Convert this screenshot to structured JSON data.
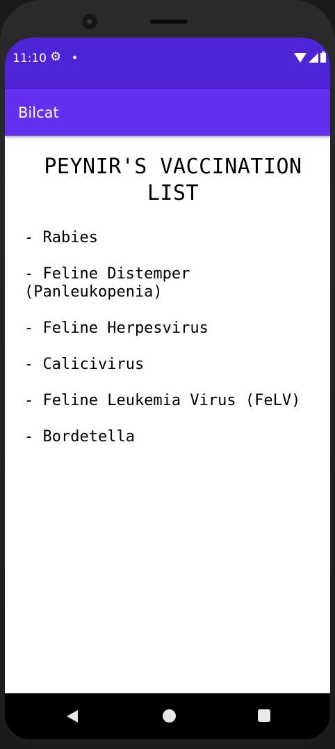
{
  "status_bar": {
    "time": "11:10",
    "icons": [
      "gear-icon",
      "notification-dot-icon",
      "wifi-icon",
      "signal-icon",
      "battery-icon"
    ]
  },
  "app_bar": {
    "title": "Bilcat",
    "color": "#6330f0"
  },
  "main": {
    "title": "PEYNIR'S VACCINATION LIST",
    "items": [
      "- Rabies",
      "- Feline Distemper (Panleukopenia)",
      "- Feline Herpesvirus",
      "- Calicivirus",
      "- Feline Leukemia Virus (FeLV)",
      "- Bordetella"
    ]
  },
  "nav_bar": {
    "icons": [
      "back-icon",
      "home-icon",
      "recents-icon"
    ]
  },
  "colors": {
    "status_bar": "#4f23d6",
    "app_bar": "#6330f0",
    "background": "#ffffff"
  }
}
